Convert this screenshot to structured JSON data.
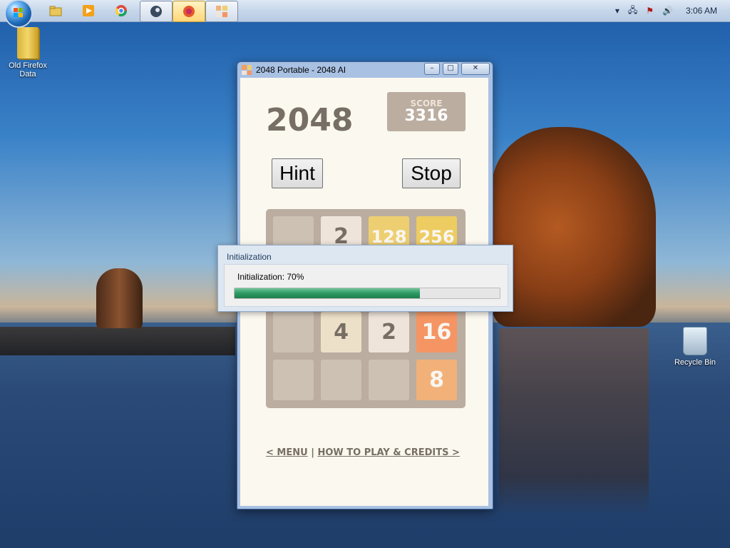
{
  "taskbar": {
    "clock": "3:06 AM",
    "pinned": [
      "explorer-icon",
      "media-player-icon",
      "chrome-icon"
    ],
    "running": [
      "steam-icon",
      "firefox-icon",
      "2048-icon"
    ]
  },
  "desktop": {
    "icons": [
      {
        "label": "Old Firefox Data"
      },
      {
        "label": "Recycle Bin"
      }
    ]
  },
  "window": {
    "title": "2048 Portable - 2048 AI",
    "controls": {
      "minimize": "–",
      "maximize": "□",
      "close": "✕"
    }
  },
  "game": {
    "title": "2048",
    "score_label": "SCORE",
    "score_value": "3316",
    "hint_label": "Hint",
    "stop_label": "Stop",
    "tiles": [
      [
        "",
        "2",
        "128",
        "256"
      ],
      [
        "",
        "",
        "",
        ""
      ],
      [
        "",
        "4",
        "2",
        "16"
      ],
      [
        "",
        "",
        "",
        "8"
      ]
    ],
    "menu_link": "< MENU",
    "separator": "|",
    "howto_link": "HOW TO PLAY & CREDITS >"
  },
  "dialog": {
    "title": "Initialization",
    "message": "Initialization: 70%",
    "progress": 0.7
  },
  "colors": {
    "tile_2": "#eee4da",
    "tile_4": "#ede0c8",
    "tile_8": "#f2b179",
    "tile_16": "#f59563",
    "tile_128": "#edcf72",
    "tile_256": "#edcc61",
    "progress_green": "#2d9a62"
  }
}
